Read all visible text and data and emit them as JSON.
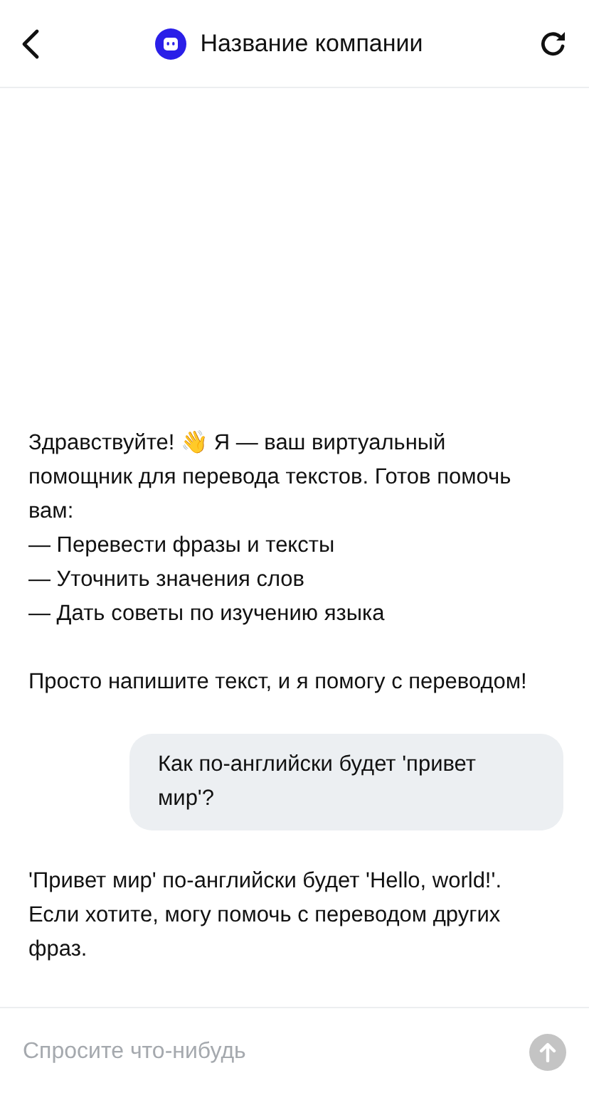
{
  "header": {
    "title": "Название компании"
  },
  "messages": [
    {
      "kind": "bot",
      "text": "Здравствуйте! 👋 Я — ваш виртуальный помощник для перевода текстов. Готов помочь вам:\n— Перевести фразы и тексты\n— Уточнить значения слов\n— Дать советы по изучению языка\n\nПросто напишите текст, и я помогу с переводом!"
    },
    {
      "kind": "user",
      "text": "Как по-английски будет 'привет мир'?"
    },
    {
      "kind": "bot",
      "text": "'Привет мир' по-английски будет 'Hello, world!'. Если хотите, могу помочь с переводом других фраз."
    }
  ],
  "composer": {
    "placeholder": "Спросите что-нибудь",
    "send_disabled": true
  }
}
